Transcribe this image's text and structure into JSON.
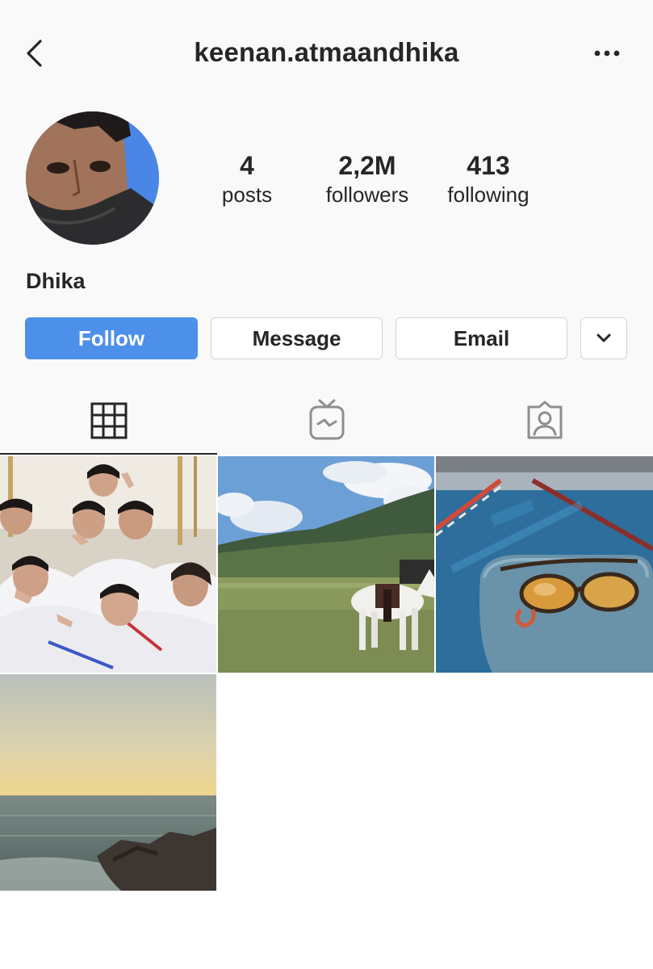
{
  "header": {
    "username": "keenan.atmaandhika",
    "back_icon": "chevron-left-icon",
    "more_icon": "ellipsis-icon"
  },
  "profile": {
    "display_name": "Dhika",
    "stats": [
      {
        "value": "4",
        "label": "posts"
      },
      {
        "value": "2,2M",
        "label": "followers"
      },
      {
        "value": "413",
        "label": "following"
      }
    ]
  },
  "actions": {
    "follow_label": "Follow",
    "message_label": "Message",
    "email_label": "Email",
    "more_icon": "chevron-down-icon"
  },
  "tabs": [
    {
      "icon": "grid-icon",
      "selected": true
    },
    {
      "icon": "igtv-icon",
      "selected": false
    },
    {
      "icon": "tagged-icon",
      "selected": false
    }
  ],
  "posts": [
    {
      "subject": "group-photo"
    },
    {
      "subject": "mountain-horse"
    },
    {
      "subject": "pool-goggles"
    },
    {
      "subject": "sunset-sea"
    }
  ],
  "colors": {
    "accent": "#4d90ea",
    "text": "#262626",
    "border": "#d3d3d3",
    "header_bg": "#f9f9f9"
  }
}
